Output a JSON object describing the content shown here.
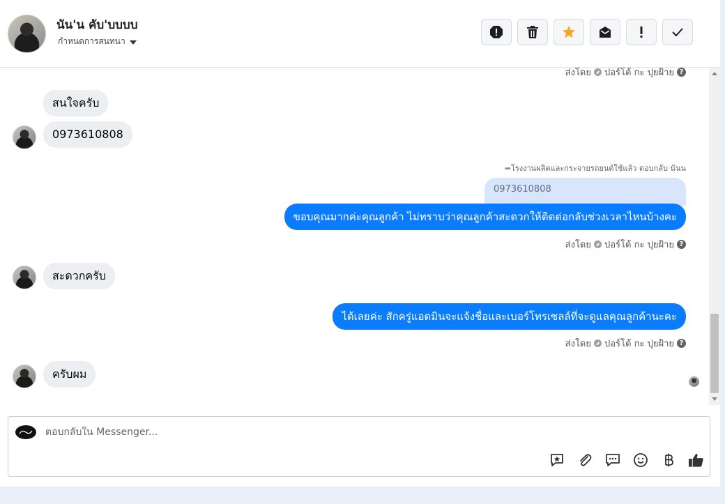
{
  "header": {
    "contact_name": "นัน'น คับ'บบบบ",
    "assign_label": "กำหนดการสนทนา"
  },
  "toolbar": {
    "buttons": [
      "spam-icon",
      "trash-icon",
      "star-icon",
      "mark-unread-icon",
      "follow-up-icon",
      "done-icon"
    ],
    "star_color": "#f5a623"
  },
  "messages": {
    "sent_by_top": "ส่งโดย",
    "sender": "ปอร์โต้ กะ ปุยฝ้าย",
    "incoming_1a": "สนใจครับ",
    "incoming_1b": "0973610808",
    "reply_meta": "โรงงานผลิตและกระจายรถยนต์ใช้แล้ว ตอบกลับ นันน",
    "quoted": "0973610808",
    "outgoing_1": "ขอบคุณมากค่ะคุณลูกค้า ไม่ทราบว่าคุณลูกค้าสะดวกให้ติดต่อกลับช่วงเวลาไหนบ้างคะ",
    "sent_by_1": "ส่งโดย",
    "incoming_2": "สะดวกครับ",
    "outgoing_2": "ได้เลยค่ะ สักครู่แอดมินจะแจ้งชื่อและเบอร์โทรเซลล์ที่จะดูแลคุณลูกค้านะคะ",
    "sent_by_2": "ส่งโดย",
    "incoming_3": "ครับผม",
    "bubble_out_color": "#0a7cff"
  },
  "composer": {
    "placeholder": "ตอบกลับใน Messenger...",
    "tools": [
      "saved-reply-icon",
      "attachment-icon",
      "quick-reply-icon",
      "emoji-icon",
      "payment-icon",
      "like-icon"
    ]
  }
}
